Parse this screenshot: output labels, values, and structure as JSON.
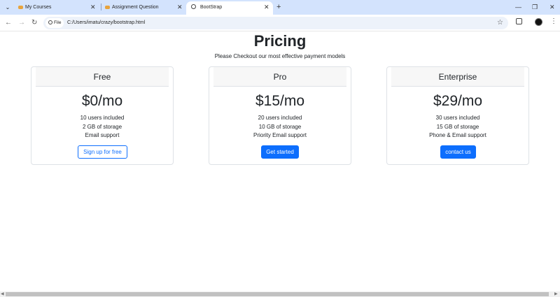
{
  "browser": {
    "tabs": [
      {
        "title": "My Courses"
      },
      {
        "title": "Assignment Question"
      },
      {
        "title": "BootStrap"
      }
    ],
    "new_tab": "+",
    "url_chip": "File",
    "url": "C:/Users/imatu/crazy/bootstrap.html"
  },
  "page": {
    "title": "Pricing",
    "subtitle": "Please Checkout our most effective payment models"
  },
  "plans": [
    {
      "name": "Free",
      "price": "$0/mo",
      "features": [
        "10 users included",
        "2 GB of storage",
        "Email support"
      ],
      "button": "Sign up for free"
    },
    {
      "name": "Pro",
      "price": "$15/mo",
      "features": [
        "20 users included",
        "10 GB of storage",
        "Priority Email support"
      ],
      "button": "Get started"
    },
    {
      "name": "Enterprise",
      "price": "$29/mo",
      "features": [
        "30 users included",
        "15 GB of storage",
        "Phone & Email support"
      ],
      "button": "contact us"
    }
  ],
  "colors": {
    "primary": "#0d6efd",
    "tabstrip": "#d3e3fd",
    "card_header": "#f7f7f7"
  }
}
